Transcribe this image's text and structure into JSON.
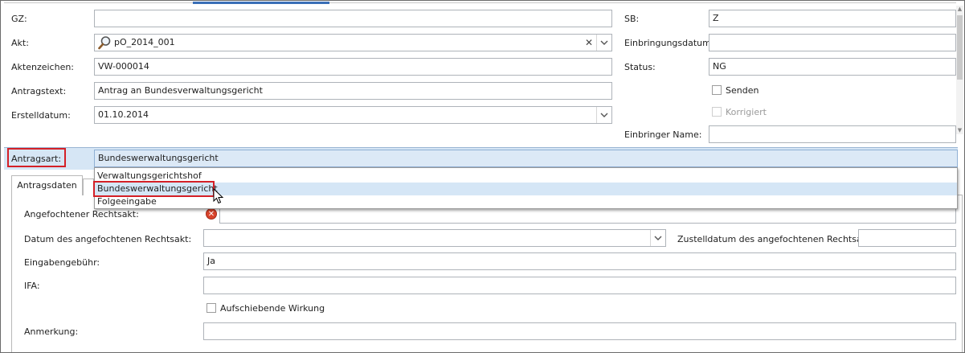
{
  "form": {
    "gz_label": "GZ:",
    "gz_value": "",
    "akt_label": "Akt:",
    "akt_value": "pO_2014_001",
    "aktenzeichen_label": "Aktenzeichen:",
    "aktenzeichen_value": "VW-000014",
    "antragstext_label": "Antragstext:",
    "antragstext_value": "Antrag an Bundesverwaltungsgericht",
    "erstelldatum_label": "Erstelldatum:",
    "erstelldatum_value": "01.10.2014",
    "sb_label": "SB:",
    "sb_value": "Z",
    "einbringungsdatum_label": "Einbringungsdatum:",
    "einbringungsdatum_value": "",
    "status_label": "Status:",
    "status_value": "NG",
    "senden_label": "Senden",
    "korrigiert_label": "Korrigiert",
    "einbringer_name_label": "Einbringer Name:",
    "einbringer_name_value": "",
    "antragsart_label": "Antragsart:",
    "antragsart_value": "Bundeswerwaltungsgericht"
  },
  "dropdown": {
    "options": [
      "Verwaltungsgerichtshof",
      "Bundeswerwaltungsgericht",
      "Folgeeingabe"
    ],
    "highlighted_index": 1
  },
  "tabs": [
    {
      "label": "Antragsdaten",
      "active": true
    },
    {
      "label": "",
      "active": false
    }
  ],
  "antragsdaten": {
    "angefochtener_label": "Angefochtener Rechtsakt:",
    "angefochtener_value": "",
    "datum_label": "Datum des angefochtenen Rechtsakt:",
    "datum_value": "",
    "zustelldatum_label": "Zustelldatum des angefochtenen Rechtsakt:",
    "zustelldatum_value": "",
    "eingabengebuehr_label": "Eingabengebühr:",
    "eingabengebuehr_value": "Ja",
    "ifa_label": "IFA:",
    "ifa_value": "",
    "aufschiebende_label": "Aufschiebende Wirkung",
    "anmerkung_label": "Anmerkung:",
    "anmerkung_value": ""
  },
  "icons": {
    "search": "magnifier-icon",
    "clear": "x-icon",
    "dropdown": "chevron-down-icon",
    "error": "error-icon",
    "cursor": "mouse-cursor-icon"
  },
  "colors": {
    "highlight_band": "#d6e6f5",
    "red_outline": "#d42027",
    "accent": "#3a6fb7"
  }
}
